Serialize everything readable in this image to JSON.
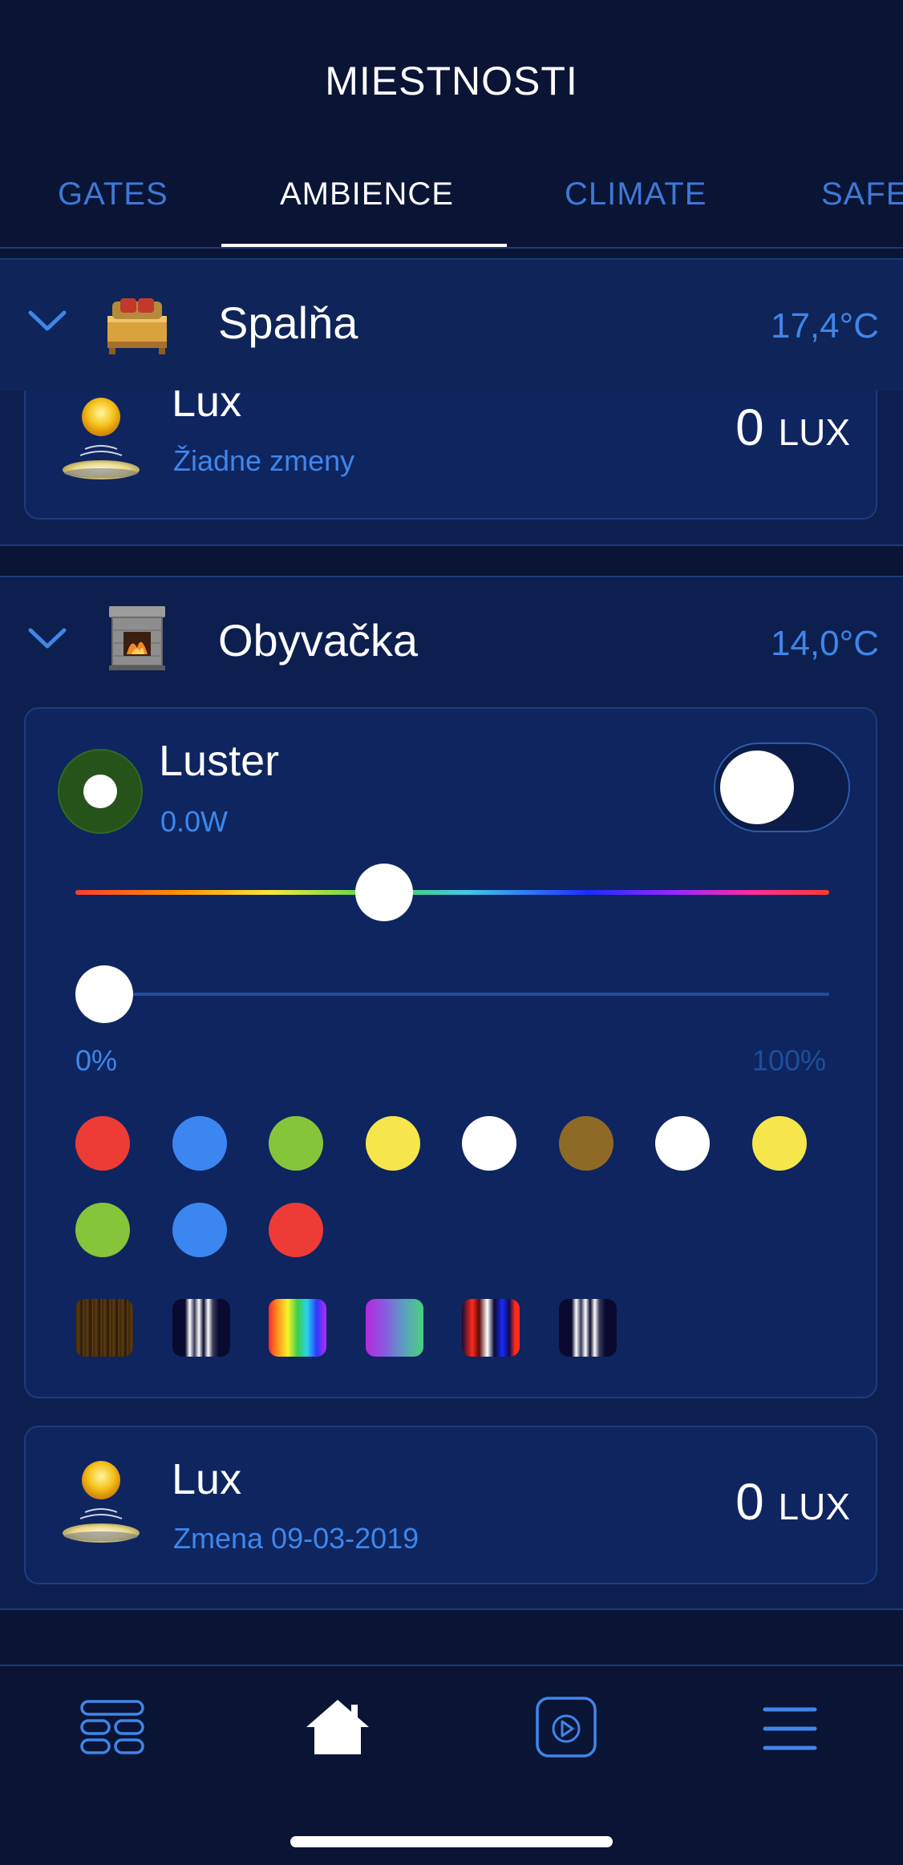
{
  "header": {
    "title": "MIESTNOSTI",
    "tabs": [
      {
        "label": "GATES",
        "active": false
      },
      {
        "label": "AMBIENCE",
        "active": true
      },
      {
        "label": "CLIMATE",
        "active": false
      },
      {
        "label": "SAFE",
        "active": false
      }
    ]
  },
  "rooms": [
    {
      "name": "Spalňa",
      "temperature": "17,4°C",
      "icon": "bed-icon",
      "devices": [
        {
          "name": "Lux",
          "status": "Žiadne zmeny",
          "value": "0",
          "unit": "LUX",
          "icon": "sun-lamp-icon"
        }
      ]
    },
    {
      "name": "Obyvačka",
      "temperature": "14,0°C",
      "icon": "fireplace-icon",
      "devices": [
        {
          "name": "Luster",
          "power": "0.0W",
          "toggle_on": false,
          "hue_position": 0.41,
          "brightness_percent": 0,
          "brightness_min_label": "0%",
          "brightness_max_label": "100%",
          "colors": [
            "#ef3b36",
            "#3b86f0",
            "#86c53a",
            "#f7e64b",
            "#ffffff",
            "#8f6a27",
            "#ffffff",
            "#f7e64b",
            "#86c53a",
            "#3b86f0",
            "#ef3b36"
          ],
          "patterns": [
            "wood-pattern",
            "white-stripes-pattern",
            "rainbow-pattern",
            "purple-green-pattern",
            "red-blue-stripes-pattern",
            "white-stripes-pattern"
          ]
        },
        {
          "name": "Lux",
          "status": "Zmena 09-03-2019",
          "value": "0",
          "unit": "LUX",
          "icon": "sun-lamp-icon"
        }
      ]
    }
  ],
  "nav": {
    "items": [
      "grid-icon",
      "home-icon",
      "play-icon",
      "menu-icon"
    ],
    "active": "home-icon"
  },
  "colors": {
    "background": "#0a1435",
    "accent": "#3f86ea"
  }
}
